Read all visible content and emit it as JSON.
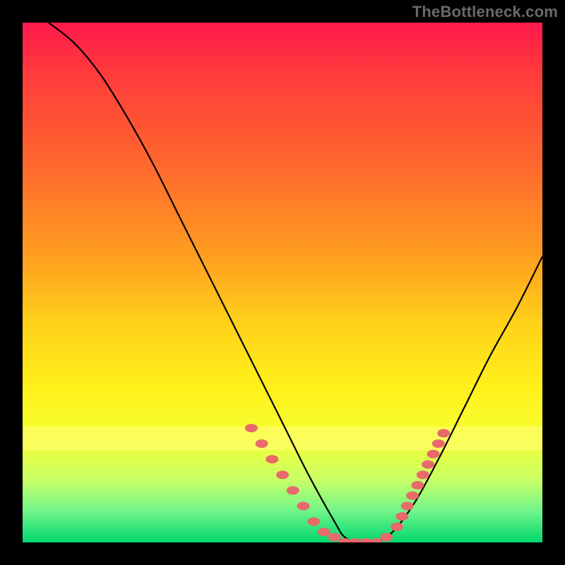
{
  "watermark": "TheBottleneck.com",
  "chart_data": {
    "type": "line",
    "title": "",
    "xlabel": "",
    "ylabel": "",
    "xlim": [
      0,
      100
    ],
    "ylim": [
      0,
      100
    ],
    "grid": false,
    "legend": false,
    "series": [
      {
        "name": "bottleneck-curve",
        "x": [
          5,
          10,
          15,
          20,
          25,
          30,
          35,
          40,
          45,
          50,
          55,
          60,
          62,
          65,
          70,
          75,
          80,
          85,
          90,
          95,
          100
        ],
        "y": [
          100,
          96,
          90,
          82,
          73,
          63,
          53,
          43,
          33,
          23,
          13,
          4,
          1,
          0,
          1,
          7,
          16,
          26,
          36,
          45,
          55
        ]
      }
    ],
    "markers": {
      "name": "data-points",
      "color": "#e86a6a",
      "points": [
        {
          "x": 44,
          "y": 22
        },
        {
          "x": 46,
          "y": 19
        },
        {
          "x": 48,
          "y": 16
        },
        {
          "x": 50,
          "y": 13
        },
        {
          "x": 52,
          "y": 10
        },
        {
          "x": 54,
          "y": 7
        },
        {
          "x": 56,
          "y": 4
        },
        {
          "x": 58,
          "y": 2
        },
        {
          "x": 60,
          "y": 1
        },
        {
          "x": 62,
          "y": 0
        },
        {
          "x": 64,
          "y": 0
        },
        {
          "x": 66,
          "y": 0
        },
        {
          "x": 68,
          "y": 0
        },
        {
          "x": 70,
          "y": 1
        },
        {
          "x": 72,
          "y": 3
        },
        {
          "x": 73,
          "y": 5
        },
        {
          "x": 74,
          "y": 7
        },
        {
          "x": 75,
          "y": 9
        },
        {
          "x": 76,
          "y": 11
        },
        {
          "x": 77,
          "y": 13
        },
        {
          "x": 78,
          "y": 15
        },
        {
          "x": 79,
          "y": 17
        },
        {
          "x": 80,
          "y": 19
        },
        {
          "x": 81,
          "y": 21
        }
      ]
    },
    "gradient_stops": [
      {
        "pos": 0,
        "color": "#ff1a4d"
      },
      {
        "pos": 50,
        "color": "#ffd21a"
      },
      {
        "pos": 100,
        "color": "#00d86e"
      }
    ]
  }
}
